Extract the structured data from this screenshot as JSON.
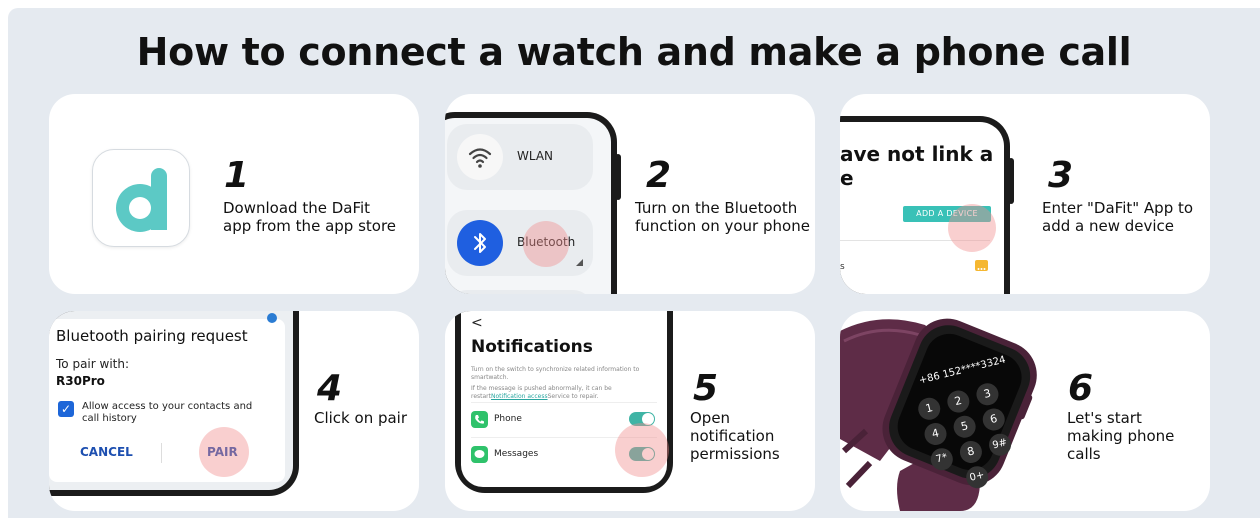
{
  "title": "How to connect a watch and make a phone call",
  "colors": {
    "background": "#e5eaf0",
    "card": "#ffffff",
    "accent_teal": "#5cc9c5",
    "bluetooth_blue": "#1f5fe0",
    "tap_highlight": "#f08c8c",
    "toggle_green": "#3fb4a5",
    "watch_strap": "#6a3550"
  },
  "steps": [
    {
      "number": "1",
      "text": "Download the DaFit\napp from the app store"
    },
    {
      "number": "2",
      "text": "Turn on the Bluetooth\nfunction on your phone"
    },
    {
      "number": "3",
      "text": "Enter \"DaFit\" App to\nadd a new device"
    },
    {
      "number": "4",
      "text": "Click on pair"
    },
    {
      "number": "5",
      "text": "Open notification\npermissions"
    },
    {
      "number": "6",
      "text": "Let's start\nmaking phone calls"
    }
  ],
  "step1": {
    "icon": "dafit-app-icon"
  },
  "step2": {
    "wlan_label": "WLAN",
    "bluetooth_label": "Bluetooth",
    "icons": [
      "wifi-icon",
      "bluetooth-icon"
    ]
  },
  "step3": {
    "heading_line1": "ave not link a",
    "heading_line2": "e",
    "add_device_button": "ADD A DEVICE",
    "list_fragment": "s",
    "icons": [
      "message-icon"
    ]
  },
  "step4": {
    "dialog_title": "Bluetooth pairing request",
    "pair_with_label": "To pair with:",
    "device_name": "R30Pro",
    "allow_access": "Allow access to your contacts and call history",
    "cancel_button": "CANCEL",
    "pair_button": "PAIR"
  },
  "step5": {
    "back_glyph": "<",
    "heading": "Notifications",
    "desc1": "Turn on the switch to synchronize related information to smartwatch.",
    "desc2_pre": "If the message is pushed abnormally, it can be restart",
    "desc2_link": "Notification access",
    "desc2_post": "Service to repair.",
    "phone_label": "Phone",
    "messages_label": "Messages"
  },
  "step6": {
    "dial_number": "+86 152****3324",
    "keys": [
      "1",
      "2",
      "3",
      "4",
      "5",
      "6",
      "7*",
      "8",
      "9#",
      "0+"
    ]
  }
}
